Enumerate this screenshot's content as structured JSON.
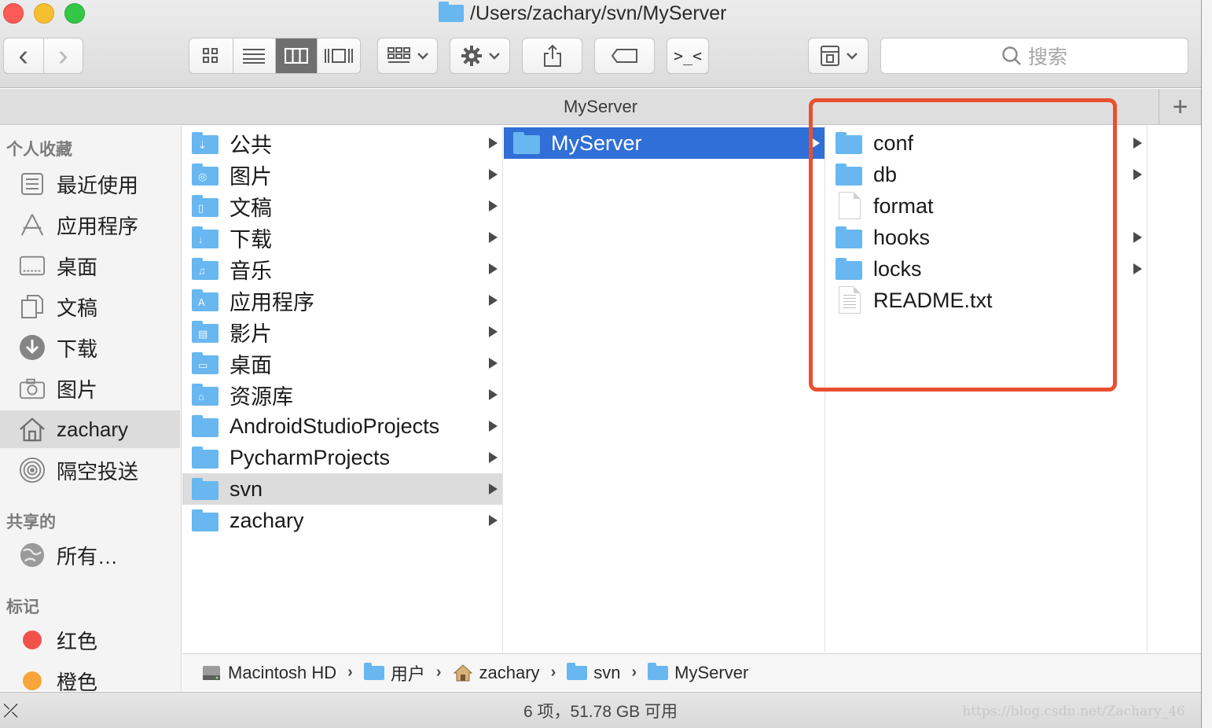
{
  "window": {
    "title": "/Users/zachary/svn/MyServer",
    "header": "MyServer"
  },
  "toolbar": {
    "back_glyph": "‹",
    "forward_glyph": "›",
    "search_placeholder": "搜索",
    "add_tab": "+",
    "terminal_glyph": ">_<"
  },
  "sidebar": {
    "favorites_heading": "个人收藏",
    "favorites": [
      {
        "label": "最近使用",
        "icon": "recents-icon"
      },
      {
        "label": "应用程序",
        "icon": "applications-icon"
      },
      {
        "label": "桌面",
        "icon": "desktop-icon"
      },
      {
        "label": "文稿",
        "icon": "documents-icon"
      },
      {
        "label": "下载",
        "icon": "downloads-icon"
      },
      {
        "label": "图片",
        "icon": "pictures-icon"
      },
      {
        "label": "zachary",
        "icon": "home-icon"
      },
      {
        "label": "隔空投送",
        "icon": "airdrop-icon"
      }
    ],
    "shared_heading": "共享的",
    "shared": [
      {
        "label": "所有…",
        "icon": "network-icon"
      }
    ],
    "tags_heading": "标记",
    "tags": [
      {
        "label": "红色",
        "color": "#f0524a"
      },
      {
        "label": "橙色",
        "color": "#f7a53b"
      }
    ]
  },
  "columns": {
    "col1": [
      {
        "name": "公共",
        "glyph": "⇣"
      },
      {
        "name": "图片",
        "glyph": "◎"
      },
      {
        "name": "文稿",
        "glyph": "▯"
      },
      {
        "name": "下载",
        "glyph": "↓"
      },
      {
        "name": "音乐",
        "glyph": "♫"
      },
      {
        "name": "应用程序",
        "glyph": "A"
      },
      {
        "name": "影片",
        "glyph": "▤"
      },
      {
        "name": "桌面",
        "glyph": "▭"
      },
      {
        "name": "资源库",
        "glyph": "⌂"
      },
      {
        "name": "AndroidStudioProjects",
        "glyph": ""
      },
      {
        "name": "PycharmProjects",
        "glyph": ""
      },
      {
        "name": "svn",
        "glyph": ""
      },
      {
        "name": "zachary",
        "glyph": ""
      }
    ],
    "col2": [
      {
        "name": "MyServer"
      }
    ],
    "col3": [
      {
        "name": "conf",
        "kind": "folder"
      },
      {
        "name": "db",
        "kind": "folder"
      },
      {
        "name": "format",
        "kind": "file"
      },
      {
        "name": "hooks",
        "kind": "folder"
      },
      {
        "name": "locks",
        "kind": "folder"
      },
      {
        "name": "README.txt",
        "kind": "text"
      }
    ]
  },
  "breadcrumb": [
    {
      "label": "Macintosh HD",
      "icon": "hard-drive-icon"
    },
    {
      "label": "用户",
      "icon": "folder-icon"
    },
    {
      "label": "zachary",
      "icon": "home-icon"
    },
    {
      "label": "svn",
      "icon": "folder-icon"
    },
    {
      "label": "MyServer",
      "icon": "folder-icon"
    }
  ],
  "status": {
    "text": "6 项，51.78 GB 可用",
    "watermark": "https://blog.csdn.net/Zachary_46"
  },
  "colors": {
    "selection_blue": "#2f6fd7",
    "folder_blue": "#68b7f0",
    "highlight_red": "#e8502f"
  }
}
